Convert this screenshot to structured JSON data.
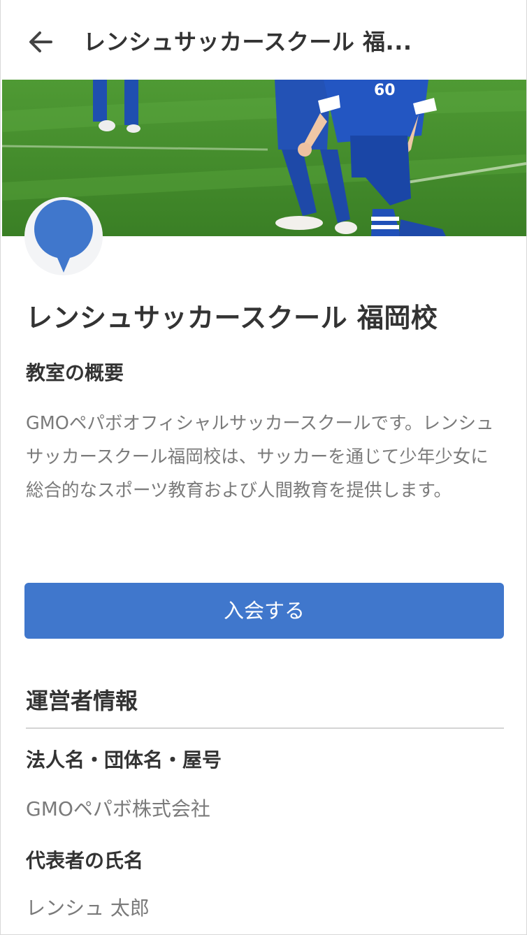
{
  "header": {
    "back_icon": "arrow-left-icon",
    "title": "レンシュサッカースクール 福..."
  },
  "school": {
    "name": "レンシュサッカースクール 福岡校",
    "logo_icon": "speech-bubble-icon",
    "jersey_number": "60"
  },
  "overview": {
    "heading": "教室の概要",
    "text": "GMOペパボオフィシャルサッカースクールです。レンシュサッカースクール福岡校は、サッカーを通じて少年少女に総合的なスポーツ教育および人間教育を提供します。"
  },
  "actions": {
    "join_label": "入会する"
  },
  "operator": {
    "heading": "運営者情報",
    "corp_label": "法人名・団体名・屋号",
    "corp_value": "GMOペパボ株式会社",
    "rep_label": "代表者の氏名",
    "rep_value": "レンシュ 太郎"
  },
  "colors": {
    "accent": "#4077cc",
    "text": "#333333",
    "muted": "#7a7a7a"
  }
}
